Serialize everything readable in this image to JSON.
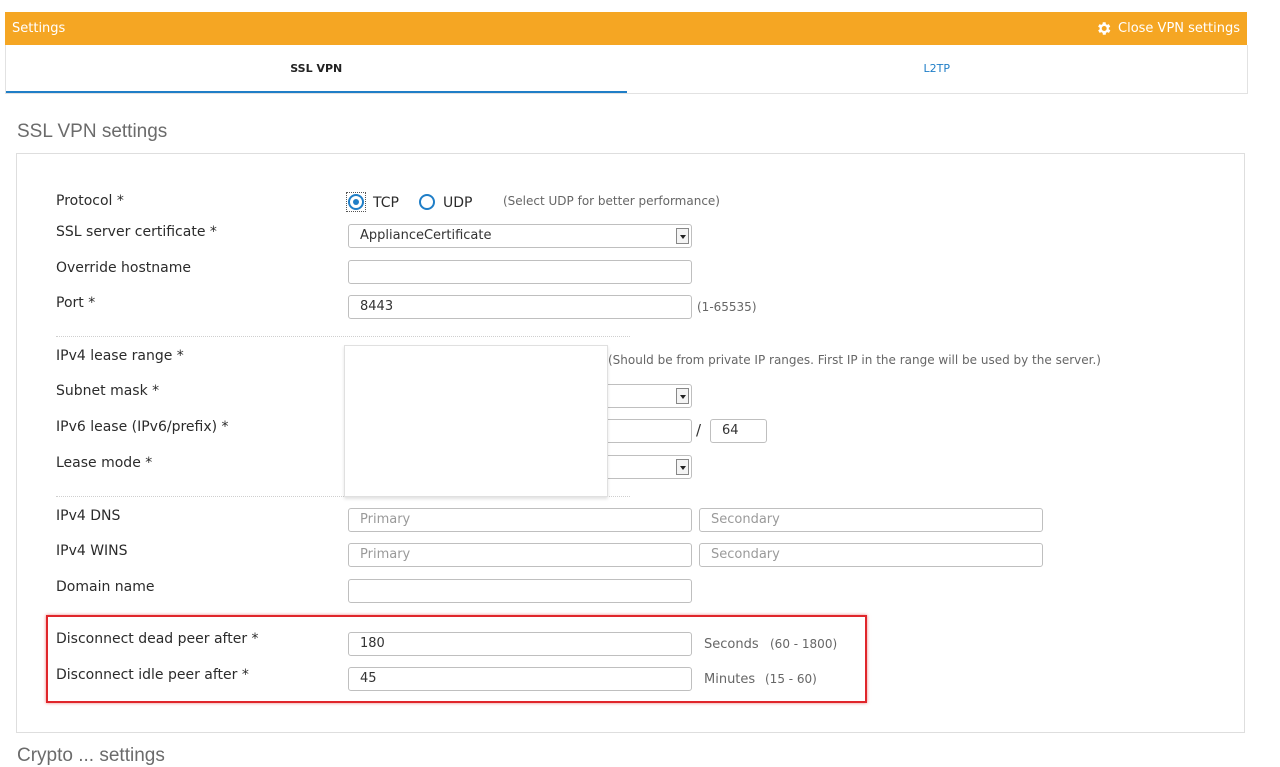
{
  "header": {
    "title": "Settings",
    "close_label": "Close VPN settings",
    "close_icon": "gear-icon",
    "accent_color": "#f5a623"
  },
  "tabs": [
    {
      "label": "SSL VPN",
      "active": true
    },
    {
      "label": "L2TP",
      "active": false
    }
  ],
  "section": {
    "title": "SSL VPN settings",
    "next_title": "Crypto ... settings"
  },
  "protocol": {
    "label": "Protocol *",
    "options": [
      "TCP",
      "UDP"
    ],
    "selected": "TCP",
    "hint": "(Select UDP for better performance)"
  },
  "certificate": {
    "label": "SSL server certificate *",
    "value": "ApplianceCertificate"
  },
  "hostname": {
    "label": "Override hostname",
    "value": ""
  },
  "port": {
    "label": "Port *",
    "value": "8443",
    "hint": "(1-65535)"
  },
  "ipv4_lease": {
    "label": "IPv4 lease range *",
    "hint": "(Should be from private IP ranges. First IP in the range will be used by the server.)"
  },
  "subnet": {
    "label": "Subnet mask *"
  },
  "ipv6_lease": {
    "label": "IPv6 lease (IPv6/prefix) *",
    "separator": "/",
    "prefix": "64"
  },
  "lease_mode": {
    "label": "Lease mode *"
  },
  "ipv4_dns": {
    "label": "IPv4 DNS",
    "primary_placeholder": "Primary",
    "secondary_placeholder": "Secondary"
  },
  "ipv4_wins": {
    "label": "IPv4 WINS",
    "primary_placeholder": "Primary",
    "secondary_placeholder": "Secondary"
  },
  "domain": {
    "label": "Domain name",
    "value": ""
  },
  "dead_peer": {
    "label": "Disconnect dead peer after *",
    "value": "180",
    "unit": "Seconds",
    "range": "(60 - 1800)"
  },
  "idle_peer": {
    "label": "Disconnect idle peer after *",
    "value": "45",
    "unit": "Minutes",
    "range": "(15 - 60)"
  }
}
